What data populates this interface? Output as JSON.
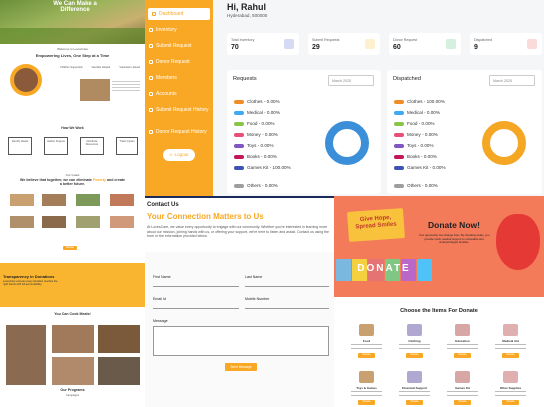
{
  "hero": {
    "title": "We Can Make a Difference"
  },
  "about": {
    "welcome": "Welcome to LovesCare",
    "heading": "Empowering Lives, One Step at a Time",
    "stats": [
      "Children Supported",
      "Families Helped",
      "Volunteers Joined"
    ],
    "how_title": "How We Work",
    "steps": [
      "Identify Needs",
      "Gather Support",
      "Distribute Resources",
      "Track Impact"
    ],
    "cause_title": "Our Goals",
    "cause_heading": "We believe that together, we can eliminate",
    "cause_heading2": "and create a better future.",
    "cause_highlight": "Poverty",
    "donate_btn": "Donate"
  },
  "sidebar": {
    "items": [
      {
        "label": "Dashboard",
        "active": true
      },
      {
        "label": "Inventory"
      },
      {
        "label": "Submit Request"
      },
      {
        "label": "Donor Request"
      },
      {
        "label": "Members"
      },
      {
        "label": "Accounts"
      },
      {
        "label": "Submit Request History"
      },
      {
        "label": "Donor Request History"
      }
    ],
    "logout": "Logout"
  },
  "dashboard": {
    "greeting": "Hi, Rahul",
    "location": "Hyderabad, 500000",
    "stats": [
      {
        "label": "Total Inventory",
        "value": "70",
        "color": "#d6dbf5"
      },
      {
        "label": "Submit Requests",
        "value": "29",
        "color": "#fdf1cf"
      },
      {
        "label": "Donor Request",
        "value": "60",
        "color": "#d6f0df"
      },
      {
        "label": "Dispatched",
        "value": "9",
        "color": "#fbdada"
      }
    ],
    "requests": {
      "title": "Requests",
      "month": "March 2025",
      "legend": [
        {
          "label": "Clothes - 0.00%",
          "color": "#f28c28"
        },
        {
          "label": "Medical - 0.00%",
          "color": "#3fa9f5"
        },
        {
          "label": "Food - 0.00%",
          "color": "#8bc34a"
        },
        {
          "label": "Money - 0.00%",
          "color": "#e94e77"
        },
        {
          "label": "Toys - 0.00%",
          "color": "#7e57c2"
        },
        {
          "label": "Books - 0.00%",
          "color": "#c2185b"
        },
        {
          "label": "Games Kit - 100.00%",
          "color": "#3f51b5"
        },
        {
          "label": "Others - 0.00%",
          "color": "#9e9e9e"
        }
      ],
      "donut_color": "#3a8fd8"
    },
    "dispatched": {
      "title": "Dispatched",
      "month": "March 2025",
      "legend": [
        {
          "label": "Clothes - 100.00%",
          "color": "#f28c28"
        },
        {
          "label": "Medical - 0.00%",
          "color": "#3fa9f5"
        },
        {
          "label": "Food - 0.00%",
          "color": "#8bc34a"
        },
        {
          "label": "Money - 0.00%",
          "color": "#e94e77"
        },
        {
          "label": "Toys - 0.00%",
          "color": "#7e57c2"
        },
        {
          "label": "Books - 0.00%",
          "color": "#c2185b"
        },
        {
          "label": "Games Kit - 0.00%",
          "color": "#3f51b5"
        },
        {
          "label": "Others - 0.00%",
          "color": "#9e9e9e"
        }
      ],
      "donut_color": "#f5a623"
    }
  },
  "contact": {
    "title": "Contact Us",
    "heading": "Your Connection Matters to Us",
    "body": "At LovesCare, we value every opportunity to engage with our community. Whether you're interested in learning more about our mission, joining hands with us, or offering your support, we're here to listen and assist. Contact us using the form or the information provided below.",
    "first_name": "First Name",
    "last_name": "Last Name",
    "email": "Email Id",
    "mobile": "Mobile Number",
    "message": "Message",
    "submit": "Send Message"
  },
  "donate": {
    "sign_line1": "Give Hope,",
    "sign_line2": "Spread Smiles",
    "title": "Donate Now!",
    "sub": "Your generosity can change lives. By donating today, you provide much-needed support to vulnerable and underprivileged families.",
    "tag": "DONATE",
    "choose_title": "Choose the Items For Donate",
    "items_row1": [
      "Food",
      "Clothing",
      "Education",
      "Medical Aid"
    ],
    "items_row2": [
      "Toys & Games",
      "Financial Support",
      "Games Kit",
      "Other Supplies"
    ],
    "btn": "Donate"
  },
  "transparency": {
    "title": "Transparency in Donations",
    "body": "LovesCare ensures every donation reaches the right hands with full accountability."
  },
  "cook": {
    "title": "You Can Cook Meals!",
    "programs": "Our Programs",
    "campaign": "Campaigns"
  }
}
